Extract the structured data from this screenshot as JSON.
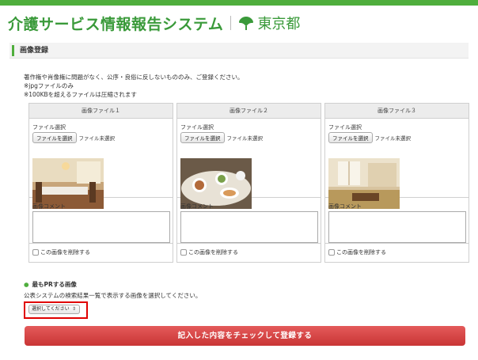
{
  "header": {
    "site_title": "介護サービス情報報告システム",
    "gov_name": "東京都",
    "logo_icon": "tokyo-ginkgo-icon",
    "accent_color": "#4fae3d"
  },
  "section": {
    "title": "画像登録"
  },
  "notes": [
    "著作権や肖像権に問題がなく、公序・良俗に反しないもののみ、ご登録ください。",
    "※jpgファイルのみ",
    "※100KBを超えるファイルは圧縮されます"
  ],
  "uploads": [
    {
      "header": "画像ファイル１",
      "select_label": "ファイル選択",
      "choose_button": "ファイルを選択",
      "file_status": "ファイル未選択",
      "comment_label": "画像コメント",
      "delete_label": "この画像を削除する"
    },
    {
      "header": "画像ファイル２",
      "select_label": "ファイル選択",
      "choose_button": "ファイルを選択",
      "file_status": "ファイル未選択",
      "comment_label": "画像コメント",
      "delete_label": "この画像を削除する"
    },
    {
      "header": "画像ファイル３",
      "select_label": "ファイル選択",
      "choose_button": "ファイルを選択",
      "file_status": "ファイル未選択",
      "comment_label": "画像コメント",
      "delete_label": "この画像を削除する"
    }
  ],
  "pr": {
    "heading": "最もPRする画像",
    "description": "公表システムの検索結果一覧で表示する画像を選択してください。",
    "select_value": "選択してください",
    "highlight_color": "#e00000"
  },
  "submit": {
    "label": "記入した内容をチェックして登録する",
    "color": "#d94444"
  }
}
